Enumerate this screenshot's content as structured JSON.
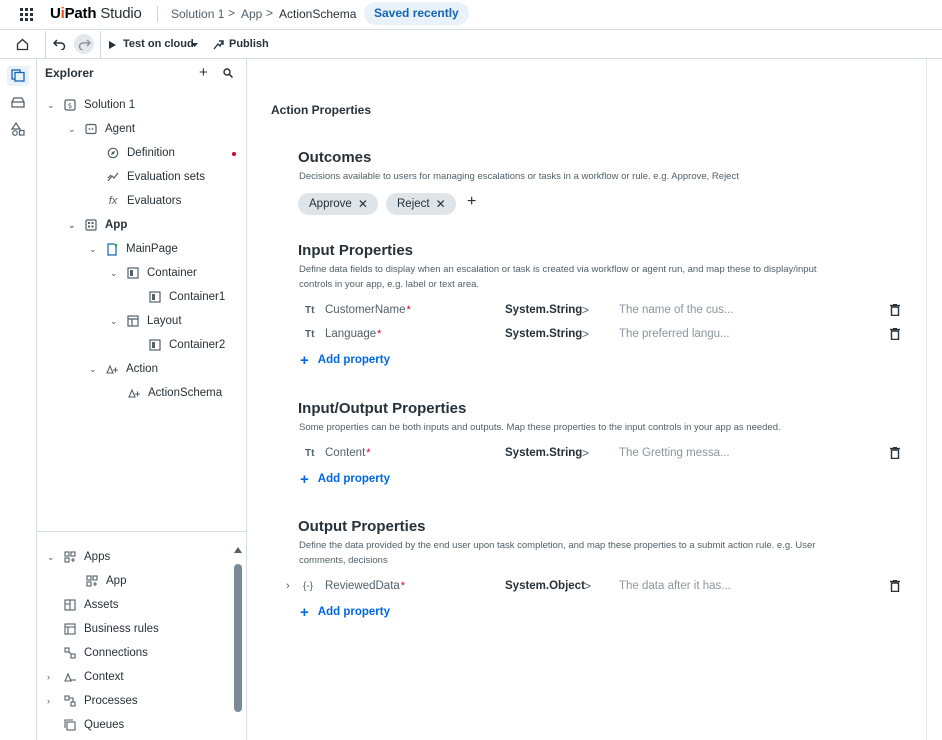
{
  "header": {
    "brand_ui": "Ui",
    "brand_path": "Path",
    "brand_studio": "Studio",
    "breadcrumbs": [
      "Solution 1",
      "App",
      "ActionSchema"
    ],
    "breadcrumb_sep": ">",
    "status_badge": "Saved recently"
  },
  "toolbar": {
    "test_label": "Test on cloud",
    "publish_label": "Publish"
  },
  "explorer": {
    "title": "Explorer",
    "tree": [
      {
        "label": "Solution 1",
        "icon": "solution-icon"
      },
      {
        "label": "Agent",
        "icon": "agent-icon"
      },
      {
        "label": "Definition",
        "icon": "definition-icon"
      },
      {
        "label": "Evaluation sets",
        "icon": "evaluation-sets-icon"
      },
      {
        "label": "Evaluators",
        "icon": "evaluators-icon"
      },
      {
        "label": "App",
        "icon": "app-icon"
      },
      {
        "label": "MainPage",
        "icon": "page-icon"
      },
      {
        "label": "Container",
        "icon": "container-icon"
      },
      {
        "label": "Container1",
        "icon": "container-icon"
      },
      {
        "label": "Layout",
        "icon": "layout-icon"
      },
      {
        "label": "Container2",
        "icon": "container-icon"
      },
      {
        "label": "Action",
        "icon": "action-icon"
      },
      {
        "label": "ActionSchema",
        "icon": "action-schema-icon"
      }
    ],
    "resources": [
      {
        "label": "Apps",
        "icon": "apps-icon"
      },
      {
        "label": "App",
        "icon": "apps-icon"
      },
      {
        "label": "Assets",
        "icon": "assets-icon"
      },
      {
        "label": "Business rules",
        "icon": "business-rules-icon"
      },
      {
        "label": "Connections",
        "icon": "connections-icon"
      },
      {
        "label": "Context",
        "icon": "context-icon"
      },
      {
        "label": "Processes",
        "icon": "processes-icon"
      },
      {
        "label": "Queues",
        "icon": "queues-icon"
      }
    ]
  },
  "main": {
    "page_title": "Action Properties",
    "outcomes": {
      "title": "Outcomes",
      "description": "Decisions available to users for managing escalations or tasks in a workflow or rule. e.g. Approve, Reject",
      "chips": [
        "Approve",
        "Reject"
      ]
    },
    "input": {
      "title": "Input Properties",
      "description": "Define data fields to display when an escalation or task is created via workflow or agent run, and map these to display/input controls in your app, e.g. label or text area.",
      "rows": [
        {
          "name": "CustomerName",
          "type": "System.String",
          "placeholder": "The name of the cus..."
        },
        {
          "name": "Language",
          "type": "System.String",
          "placeholder": "The preferred langu..."
        }
      ]
    },
    "inout": {
      "title": "Input/Output Properties",
      "description": "Some properties can be both inputs and outputs. Map these properties to the input controls in your app as needed.",
      "rows": [
        {
          "name": "Content",
          "type": "System.String",
          "placeholder": "The Gretting messa..."
        }
      ]
    },
    "output": {
      "title": "Output Properties",
      "description": "Define the data provided by the end user upon task completion, and map these properties to a submit action rule. e.g. User comments, decisions",
      "rows": [
        {
          "name": "ReviewedData",
          "type": "System.Object",
          "placeholder": "The data after it has..."
        }
      ]
    },
    "add_property_label": "Add property",
    "required_marker": "*",
    "type_chevron": ">",
    "text_type_glyph": "Tt",
    "object_type_glyph": "{-}"
  },
  "colors": {
    "accent": "#0067df",
    "brand_orange": "#fa4616",
    "required": "#d1002a",
    "badge_bg": "#e9f1fa",
    "chip_bg": "#dfe4e8"
  }
}
